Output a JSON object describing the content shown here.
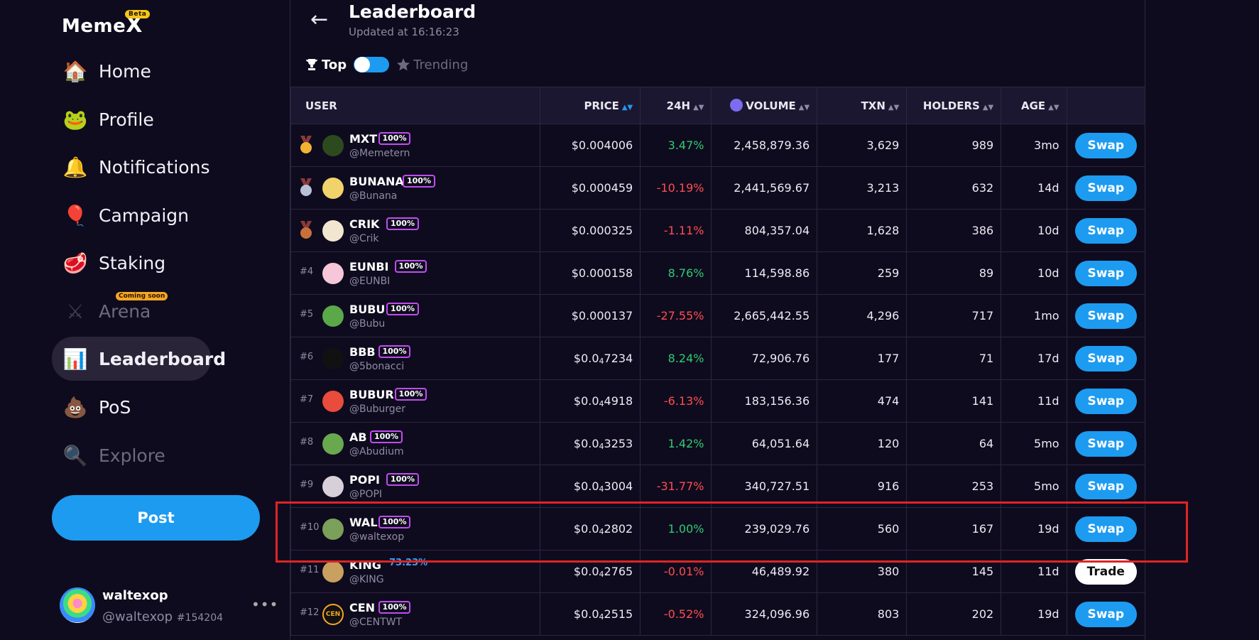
{
  "brand": {
    "name": "Meme",
    "x": "X",
    "badge": "Beta"
  },
  "nav": [
    {
      "label": "Home",
      "icon": "house-icon",
      "glyph": "🏠",
      "state": "normal"
    },
    {
      "label": "Profile",
      "icon": "pepe-icon",
      "glyph": "🐸",
      "state": "normal"
    },
    {
      "label": "Notifications",
      "icon": "bell-icon",
      "glyph": "🔔",
      "state": "normal"
    },
    {
      "label": "Campaign",
      "icon": "balloon-icon",
      "glyph": "🎈",
      "state": "normal"
    },
    {
      "label": "Staking",
      "icon": "meat-icon",
      "glyph": "🥩",
      "state": "normal"
    },
    {
      "label": "Arena",
      "icon": "swords-icon",
      "glyph": "⚔",
      "state": "disabled",
      "badge": "Coming soon"
    },
    {
      "label": "Leaderboard",
      "icon": "podium-icon",
      "glyph": "📊",
      "state": "active"
    },
    {
      "label": "PoS",
      "icon": "poop-icon",
      "glyph": "💩",
      "state": "normal"
    },
    {
      "label": "Explore",
      "icon": "magnifier-icon",
      "glyph": "🔍",
      "state": "disabled"
    }
  ],
  "post_label": "Post",
  "account": {
    "name": "waltexop",
    "handle": "@waltexop",
    "number": "#154204",
    "more": "•••"
  },
  "header": {
    "back": "←",
    "title": "Leaderboard",
    "updated": "Updated at 16:16:23"
  },
  "filters": {
    "top": "Top",
    "trending": "Trending"
  },
  "columns": {
    "user": "USER",
    "price": "PRICE",
    "change": "24H",
    "volume": "VOLUME",
    "txn": "TXN",
    "holders": "HOLDERS",
    "age": "AGE"
  },
  "rows": [
    {
      "rank": "",
      "medal": "gold",
      "name": "MXT",
      "pct": "100%",
      "handle": "@Memetern",
      "price": "$0.004006",
      "change": "3.47%",
      "dir": "pos",
      "volume": "2,458,879.36",
      "txn": "3,629",
      "holders": "989",
      "age": "3mo",
      "action": "Swap",
      "av": "#2d4a1e"
    },
    {
      "rank": "",
      "medal": "silver",
      "name": "BUNANA",
      "pct": "100%",
      "handle": "@Bunana",
      "price": "$0.000459",
      "change": "-10.19%",
      "dir": "neg",
      "volume": "2,441,569.67",
      "txn": "3,213",
      "holders": "632",
      "age": "14d",
      "action": "Swap",
      "av": "#f1d36b"
    },
    {
      "rank": "",
      "medal": "bronze",
      "name": "CRIK",
      "pct": "100%",
      "handle": "@Crik",
      "price": "$0.000325",
      "change": "-1.11%",
      "dir": "neg",
      "volume": "804,357.04",
      "txn": "1,628",
      "holders": "386",
      "age": "10d",
      "action": "Swap",
      "av": "#f3e6d0"
    },
    {
      "rank": "#4",
      "medal": "",
      "name": "EUNBI",
      "pct": "100%",
      "handle": "@EUNBI",
      "price": "$0.000158",
      "change": "8.76%",
      "dir": "pos",
      "volume": "114,598.86",
      "txn": "259",
      "holders": "89",
      "age": "10d",
      "action": "Swap",
      "av": "#f6c7d8"
    },
    {
      "rank": "#5",
      "medal": "",
      "name": "BUBU",
      "pct": "100%",
      "handle": "@Bubu",
      "price": "$0.000137",
      "change": "-27.55%",
      "dir": "neg",
      "volume": "2,665,442.55",
      "txn": "4,296",
      "holders": "717",
      "age": "1mo",
      "action": "Swap",
      "av": "#5aa84a"
    },
    {
      "rank": "#6",
      "medal": "",
      "name": "BBB",
      "pct": "100%",
      "handle": "@5bonacci",
      "price": "$0.0",
      "price_sub": "4",
      "price_tail": "7234",
      "change": "8.24%",
      "dir": "pos",
      "volume": "72,906.76",
      "txn": "177",
      "holders": "71",
      "age": "17d",
      "action": "Swap",
      "av": "#111111"
    },
    {
      "rank": "#7",
      "medal": "",
      "name": "BUBUR",
      "pct": "100%",
      "handle": "@Buburger",
      "price": "$0.0",
      "price_sub": "4",
      "price_tail": "4918",
      "change": "-6.13%",
      "dir": "neg",
      "volume": "183,156.36",
      "txn": "474",
      "holders": "141",
      "age": "11d",
      "action": "Swap",
      "av": "#e94b3c"
    },
    {
      "rank": "#8",
      "medal": "",
      "name": "AB",
      "pct": "100%",
      "handle": "@Abudium",
      "price": "$0.0",
      "price_sub": "4",
      "price_tail": "3253",
      "change": "1.42%",
      "dir": "pos",
      "volume": "64,051.64",
      "txn": "120",
      "holders": "64",
      "age": "5mo",
      "action": "Swap",
      "av": "#6aa84f"
    },
    {
      "rank": "#9",
      "medal": "",
      "name": "POPI",
      "pct": "100%",
      "handle": "@POPI",
      "price": "$0.0",
      "price_sub": "4",
      "price_tail": "3004",
      "change": "-31.77%",
      "dir": "neg",
      "volume": "340,727.51",
      "txn": "916",
      "holders": "253",
      "age": "5mo",
      "action": "Swap",
      "av": "#d8d0d8"
    },
    {
      "rank": "#10",
      "medal": "",
      "name": "WAL",
      "pct": "100%",
      "handle": "@waltexop",
      "price": "$0.0",
      "price_sub": "4",
      "price_tail": "2802",
      "change": "1.00%",
      "dir": "pos",
      "volume": "239,029.76",
      "txn": "560",
      "holders": "167",
      "age": "19d",
      "action": "Swap",
      "av": "#7aa05a"
    },
    {
      "rank": "#11",
      "medal": "",
      "name": "KING",
      "pct": "73.23%",
      "pct_plain": true,
      "handle": "@KING",
      "price": "$0.0",
      "price_sub": "4",
      "price_tail": "2765",
      "change": "-0.01%",
      "dir": "neg",
      "volume": "46,489.92",
      "txn": "380",
      "holders": "145",
      "age": "11d",
      "action": "Trade",
      "av": "#c8a060"
    },
    {
      "rank": "#12",
      "medal": "",
      "name": "CEN",
      "pct": "100%",
      "handle": "@CENTWT",
      "price": "$0.0",
      "price_sub": "4",
      "price_tail": "2515",
      "change": "-0.52%",
      "dir": "neg",
      "volume": "324,096.96",
      "txn": "803",
      "holders": "202",
      "age": "19d",
      "action": "Swap",
      "av": "#111111",
      "av_text": "CEN"
    }
  ],
  "colors": {
    "accent": "#1d9bf0",
    "positive": "#2ecc71",
    "negative": "#ff4d4f",
    "highlight": "#e02424"
  }
}
